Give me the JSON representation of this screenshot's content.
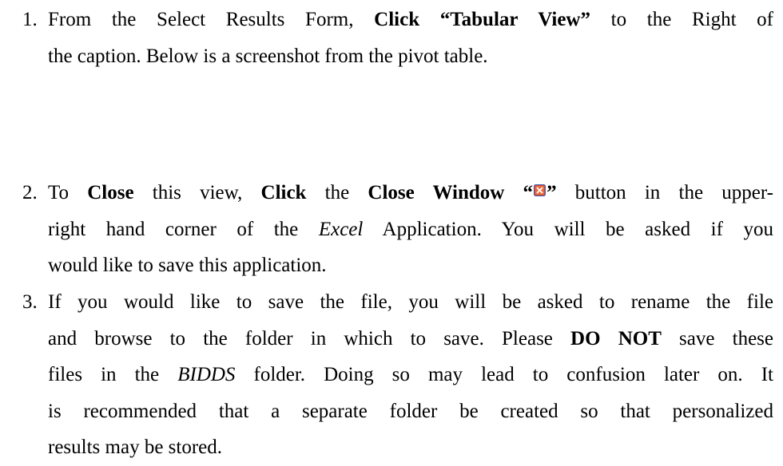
{
  "document": {
    "items": [
      {
        "number": "1.",
        "lines": [
          {
            "segments": [
              {
                "t": "From the Select Results Form, "
              },
              {
                "t": "Click “Tabular View”",
                "b": true
              },
              {
                "t": " to the Right of"
              }
            ]
          },
          {
            "segments": [
              {
                "t": "the caption.  Below is a screenshot from the pivot table."
              }
            ]
          }
        ]
      },
      {
        "number": "2.",
        "lines": [
          {
            "segments": [
              {
                "t": "To "
              },
              {
                "t": "Close",
                "b": true
              },
              {
                "t": " this view, "
              },
              {
                "t": "Click",
                "b": true
              },
              {
                "t": " the "
              },
              {
                "t": "Close Window “",
                "b": true
              },
              {
                "icon": "close-window-icon"
              },
              {
                "t": "”",
                "b": true
              },
              {
                "t": " button in the upper-"
              }
            ]
          },
          {
            "segments": [
              {
                "t": "right hand corner of the "
              },
              {
                "t": "Excel",
                "i": true
              },
              {
                "t": " Application.  You will be asked if you"
              }
            ]
          },
          {
            "segments": [
              {
                "t": "would like to save this application."
              }
            ]
          }
        ]
      },
      {
        "number": "3.",
        "lines": [
          {
            "segments": [
              {
                "t": "If you would like to save the file, you will be asked to rename the file"
              }
            ]
          },
          {
            "segments": [
              {
                "t": "and browse to the folder in which to save.  Please "
              },
              {
                "t": "DO NOT",
                "b": true
              },
              {
                "t": " save these"
              }
            ]
          },
          {
            "segments": [
              {
                "t": "files in the "
              },
              {
                "t": "BIDDS",
                "i": true
              },
              {
                "t": " folder.  Doing so may lead to confusion later on.  It"
              }
            ]
          },
          {
            "segments": [
              {
                "t": "is recommended that a separate folder be created so that personalized"
              }
            ]
          },
          {
            "segments": [
              {
                "t": "results may be stored."
              }
            ]
          }
        ]
      }
    ]
  }
}
